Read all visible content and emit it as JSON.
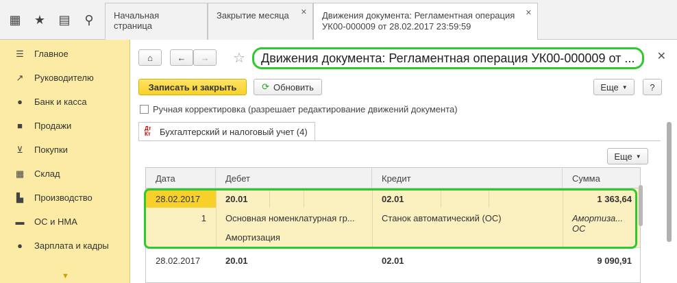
{
  "tabs": [
    {
      "label": "Начальная страница",
      "closable": false
    },
    {
      "label": "Закрытие месяца",
      "closable": true
    },
    {
      "label": "Движения документа: Регламентная операция УК00-000009 от 28.02.2017 23:59:59",
      "closable": true
    }
  ],
  "topicons": [
    "grid-icon",
    "star-icon",
    "history-icon",
    "search-icon"
  ],
  "sidebar": {
    "items": [
      {
        "label": "Главное",
        "icon": "menu-icon"
      },
      {
        "label": "Руководителю",
        "icon": "trend-icon"
      },
      {
        "label": "Банк и касса",
        "icon": "ruble-icon"
      },
      {
        "label": "Продажи",
        "icon": "bag-icon"
      },
      {
        "label": "Покупки",
        "icon": "cart-icon"
      },
      {
        "label": "Склад",
        "icon": "warehouse-icon"
      },
      {
        "label": "Производство",
        "icon": "factory-icon"
      },
      {
        "label": "ОС и НМА",
        "icon": "truck-icon"
      },
      {
        "label": "Зарплата и кадры",
        "icon": "person-icon"
      }
    ]
  },
  "doc": {
    "title": "Движения документа: Регламентная операция УК00-000009 от ...",
    "save_close": "Записать и закрыть",
    "refresh": "Обновить",
    "more": "Еще",
    "help": "?",
    "manual_correction": "Ручная корректировка (разрешает редактирование движений документа)",
    "subtab": "Бухгалтерский и налоговый учет (4)",
    "subtab_icon_text": "Дт\nКт",
    "table_more": "Еще"
  },
  "table": {
    "headers": [
      "Дата",
      "Дебет",
      "Кредит",
      "Сумма"
    ],
    "rows": [
      {
        "date": "28.02.2017",
        "num": "1",
        "debet": "20.01",
        "debet_sub1": "Основная номенклатурная гр...",
        "debet_sub2": "Амортизация",
        "kredit": "02.01",
        "kredit_sub1": "Станок автоматический (ОС)",
        "summa": "1 363,64",
        "summa_sub": "Амортиза... ОС"
      },
      {
        "date": "28.02.2017",
        "debet": "20.01",
        "kredit": "02.01",
        "summa": "9 090,91"
      }
    ]
  }
}
